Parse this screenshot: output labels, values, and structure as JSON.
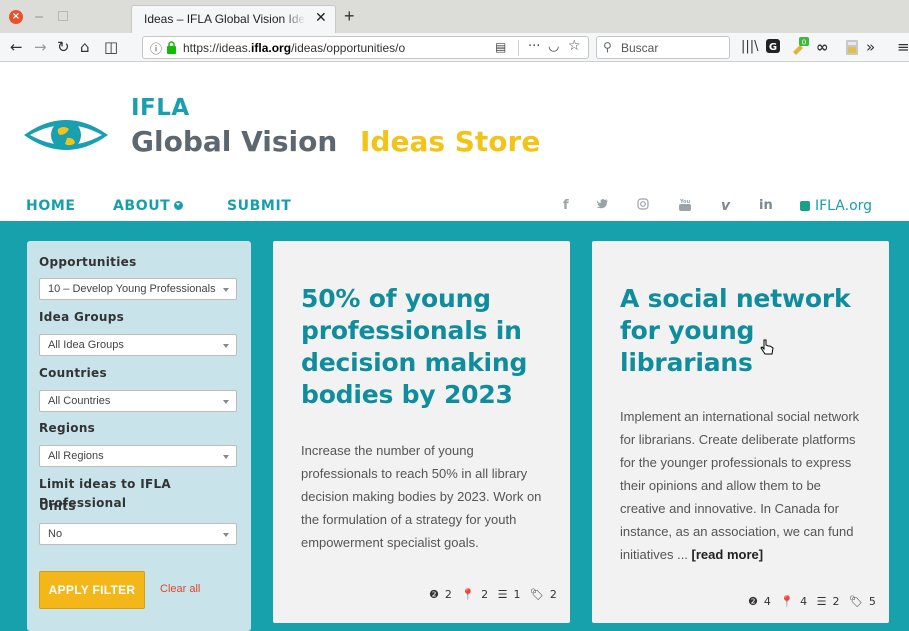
{
  "browser": {
    "tab_title": "Ideas – IFLA Global Vision Ideas Store",
    "tab_close": "✕",
    "new_tab": "+",
    "url_prefix": "https://ideas.",
    "url_domain": "ifla.org",
    "url_rest": "/ideas/opportunities/o",
    "search_placeholder": "Buscar",
    "nav_icons": [
      "back-icon",
      "forward-icon",
      "reload-icon",
      "home-icon",
      "sidebar-icon"
    ]
  },
  "site": {
    "logo_top": "IFLA",
    "logo_main": "Global Vision",
    "logo_store": "Ideas Store",
    "colors": {
      "teal": "#17a1ac",
      "yellow": "#f2c41a",
      "gray": "#5c6770"
    }
  },
  "nav": {
    "home": "HOME",
    "about": "ABOUT",
    "submit": "SUBMIT",
    "social": [
      "f",
      "🐦",
      "◎",
      "▶",
      "v",
      "in"
    ],
    "ifla_org": "IFLA.org"
  },
  "filter": {
    "opportunities_label": "Opportunities",
    "opportunities_value": "10 – Develop Young Professionals",
    "idea_groups_label": "Idea Groups",
    "idea_groups_value": "All Idea Groups",
    "countries_label": "Countries",
    "countries_value": "All Countries",
    "regions_label": "Regions",
    "regions_value": "All Regions",
    "limit_label_1": "Limit ideas to IFLA Professional",
    "limit_label_2": "Units",
    "limit_value": "No",
    "apply_label": "APPLY FILTER",
    "clear_label": "Clear all"
  },
  "cards": [
    {
      "title": "50% of young professionals in decision making bodies by 2023",
      "description": "Increase the number of young professionals to reach 50% in all library decision making bodies by 2023. Work on the formulation of a strategy for youth empowerment specialist goals.",
      "more": "",
      "stats": {
        "comments": "2",
        "pins": "2",
        "lists": "1",
        "tags": "2"
      }
    },
    {
      "title": "A social network for young librarians",
      "description": "Implement an international social network for librarians. Create deliberate platforms for the younger professionals to express their opinions and allow them to be creative and innovative. In Canada for instance, as an association, we can fund initiatives ...",
      "more": "[read more]",
      "stats": {
        "comments": "4",
        "pins": "4",
        "lists": "2",
        "tags": "5"
      }
    }
  ]
}
